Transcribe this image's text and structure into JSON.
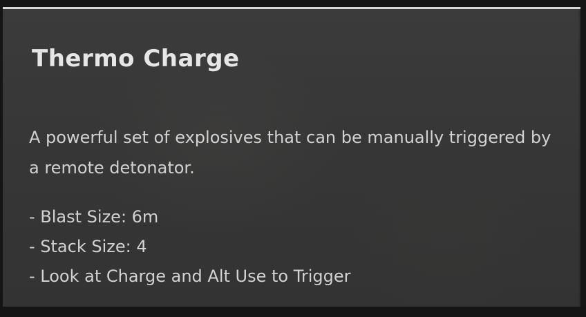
{
  "tooltip": {
    "title": "Thermo Charge",
    "description": "A powerful set of explosives that can be manually triggered by a remote detonator.",
    "stats": [
      "- Blast Size: 6m",
      "- Stack Size: 4",
      "- Look at Charge and Alt Use to Trigger"
    ]
  },
  "colors": {
    "panel_background": "#363636",
    "top_border": "#d8d8d8",
    "title_text": "#e6e6e6",
    "body_text": "#d2d2d2"
  }
}
